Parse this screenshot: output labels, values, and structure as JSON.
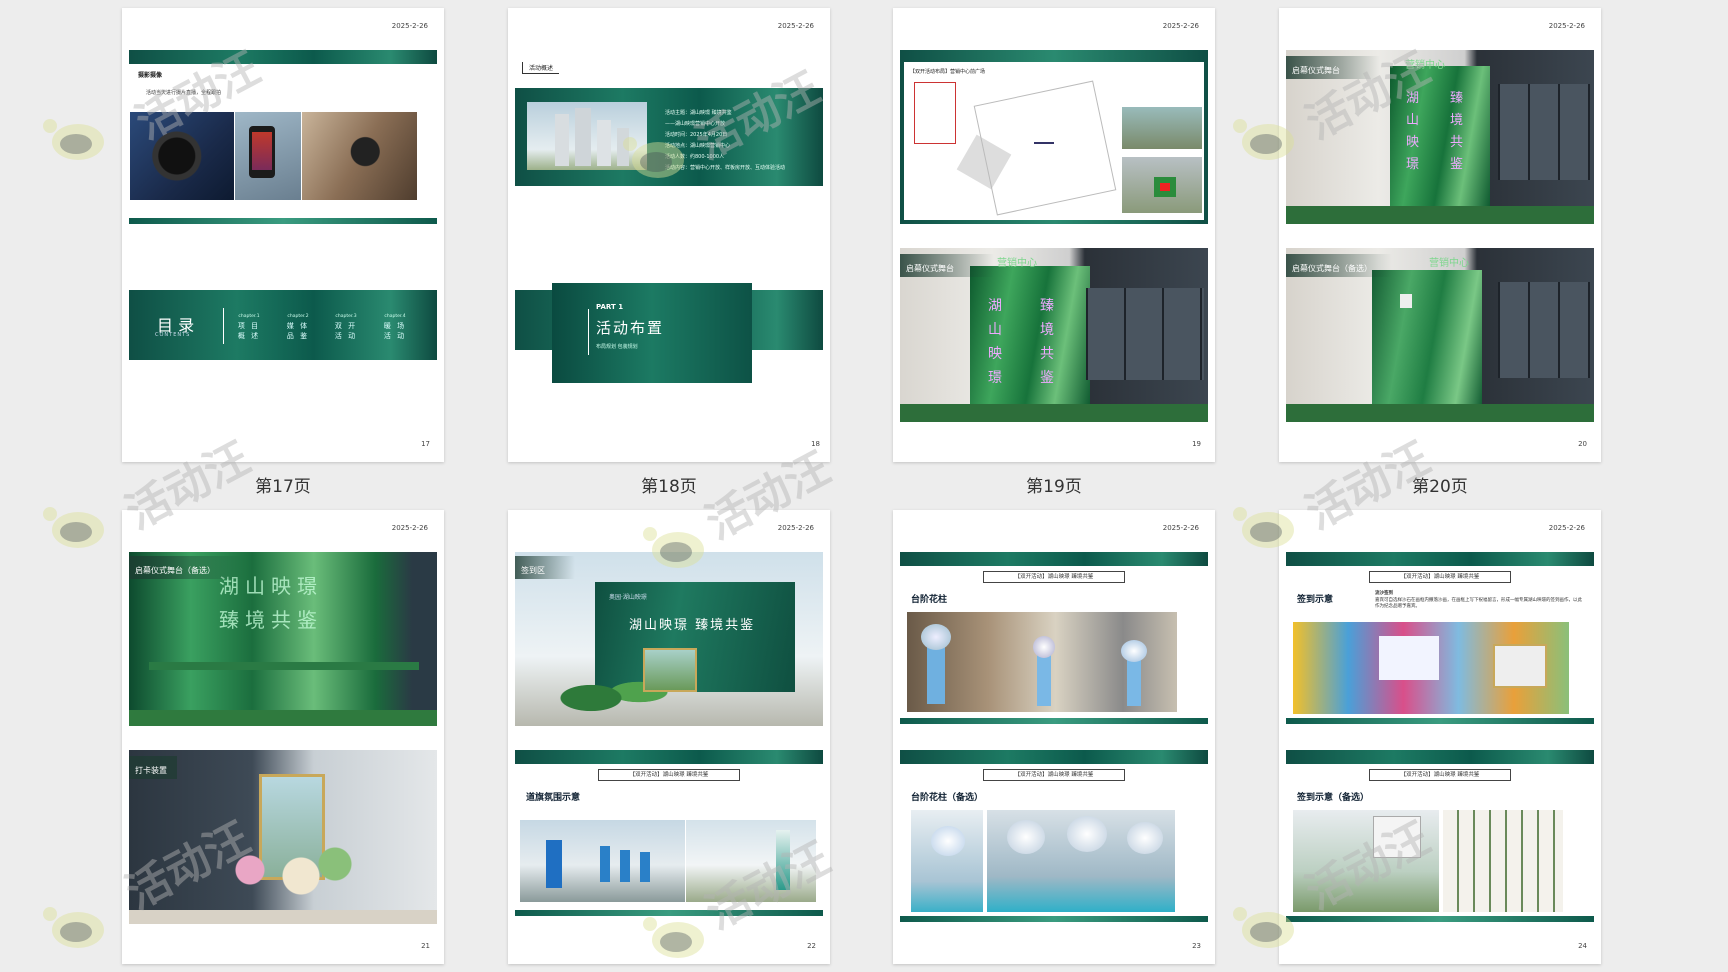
{
  "pages": [
    {
      "date": "2025-2-26",
      "num": "17",
      "caption": "第17页",
      "section_label": "摄影摄像",
      "note": "活动当天进行摄片直播，全程跟拍",
      "toc": {
        "title": "目 录",
        "sub": "CONTENTS",
        "items": [
          {
            "ch": "chapter.1",
            "t": "项 目 概 述"
          },
          {
            "ch": "chapter.2",
            "t": "媒 体 品 鉴"
          },
          {
            "ch": "chapter.3",
            "t": "双 开 活 动"
          },
          {
            "ch": "chapter.4",
            "t": "暖 场 活 动"
          }
        ]
      }
    },
    {
      "date": "2025-2-26",
      "num": "18",
      "caption": "第18页",
      "tag": "活动概述",
      "info": [
        "活动主题：湖山映璟 臻境共鉴",
        "——湖山映璟营销中心开放",
        "活动时间：2025年4月20日",
        "活动地点：湖山映璟营销中心",
        "活动人数：约800-1000人",
        "活动内容：营销中心开放、样板房开放、互动体验活动"
      ],
      "part": "PART 1",
      "part_title": "活动布置",
      "part_sub": "布局规划 包装规划"
    },
    {
      "date": "2025-2-26",
      "num": "19",
      "caption": "第19页",
      "map_title": "【双开活动布局】营销中心前广场",
      "stage_label": "启幕仪式舞台",
      "stage_tag": "营销中心",
      "wall_text": [
        "湖",
        "臻",
        "山",
        "境",
        "映",
        "共",
        "璟",
        "鉴"
      ]
    },
    {
      "date": "2025-2-26",
      "num": "20",
      "caption": "第20页",
      "stage_label": "启幕仪式舞台",
      "stage_tag": "营销中心",
      "alt_label": "启幕仪式舞台（备选）",
      "alt_tag": "营销中心",
      "wall_text": [
        "湖",
        "臻",
        "山",
        "境",
        "映",
        "共",
        "璟",
        "鉴"
      ]
    },
    {
      "date": "2025-2-26",
      "num": "21",
      "caption": "",
      "stage_label": "启幕仪式舞台（备选）",
      "backdrop": [
        "湖山映璟",
        "臻境共鉴"
      ],
      "checkin_label": "打卡装置"
    },
    {
      "date": "2025-2-26",
      "num": "22",
      "caption": "",
      "signin_label": "签到区",
      "wall_title": "湖山映璟 臻境共鉴",
      "wall_brand": "奥园·湖山映璟",
      "header": "【双开活动】湖山映璟 臻境共鉴",
      "road_label": "道旗氛围示意"
    },
    {
      "date": "2025-2-26",
      "num": "23",
      "caption": "",
      "header": "【双开活动】湖山映璟 臻境共鉴",
      "a_label": "台阶花柱",
      "header2": "【双开活动】湖山映璟 臻境共鉴",
      "b_label": "台阶花柱（备选）"
    },
    {
      "date": "2025-2-26",
      "num": "24",
      "caption": "",
      "header": "【双开活动】湖山映璟 臻境共鉴",
      "a_label": "签到示意",
      "a_note_title": "流沙签到",
      "a_note": "嘉宾可自选样沙石在画框内撒落沙画，在画框上写下祝福留言，形成一幅专属湖山映璟的签到画作，以此作为纪念品赠予嘉宾。",
      "header2": "【双开活动】湖山映璟 臻境共鉴",
      "b_label": "签到示意（备选）"
    }
  ],
  "watermark": "活动汪",
  "colors": {
    "band": "#0f4f45",
    "accent": "#1d7a63",
    "bg": "#ededed"
  }
}
